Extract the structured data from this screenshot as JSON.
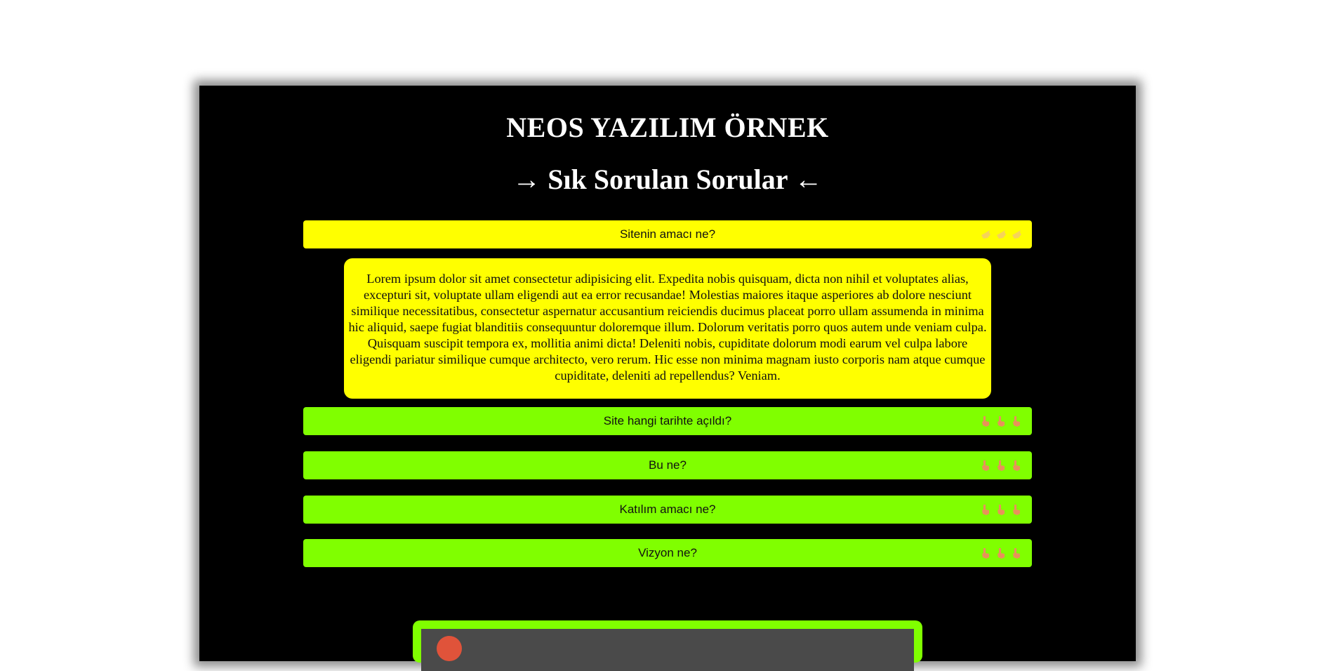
{
  "header": {
    "site_title": "NEOS YAZILIM ÖRNEK",
    "faq_heading": "→ Sık Sorulan Sorular ←"
  },
  "faq": {
    "items": [
      {
        "label": "Sitenin amacı ne?",
        "state": "open",
        "icon": "pointing-hand-icon"
      },
      {
        "label": "Site hangi tarihte açıldı?",
        "state": "closed",
        "icon": "pointing-hand-icon"
      },
      {
        "label": "Bu ne?",
        "state": "closed",
        "icon": "pointing-hand-icon"
      },
      {
        "label": "Katılım amacı ne?",
        "state": "closed",
        "icon": "pointing-hand-icon"
      },
      {
        "label": "Vizyon ne?",
        "state": "closed",
        "icon": "pointing-hand-icon"
      }
    ],
    "open_answer": "Lorem ipsum dolor sit amet consectetur adipisicing elit. Expedita nobis quisquam, dicta non nihil et voluptates alias, excepturi sit, voluptate ullam eligendi aut ea error recusandae! Molestias maiores itaque asperiores ab dolore nesciunt similique necessitatibus, consectetur aspernatur accusantium reiciendis ducimus placeat porro ullam assumenda in minima hic aliquid, saepe fugiat blanditiis consequuntur doloremque illum. Dolorum veritatis porro quos autem unde veniam culpa. Quisquam suscipit tempora ex, mollitia animi dicta! Deleniti nobis, cupiditate dolorum modi earum vel culpa labore eligendi pariatur similique cumque architecto, vero rerum. Hic esse non minima magnam iusto corporis nam atque cumque cupiditate, deleniti ad repellendus? Veniam."
  },
  "colors": {
    "page_background": "#ffffff",
    "frame_background": "#000000",
    "open_item": "#ffff00",
    "closed_item": "#80ff00",
    "media_border": "#80ff00",
    "hand_open": "#f6d35a",
    "hand_closed": "#e8925a"
  }
}
